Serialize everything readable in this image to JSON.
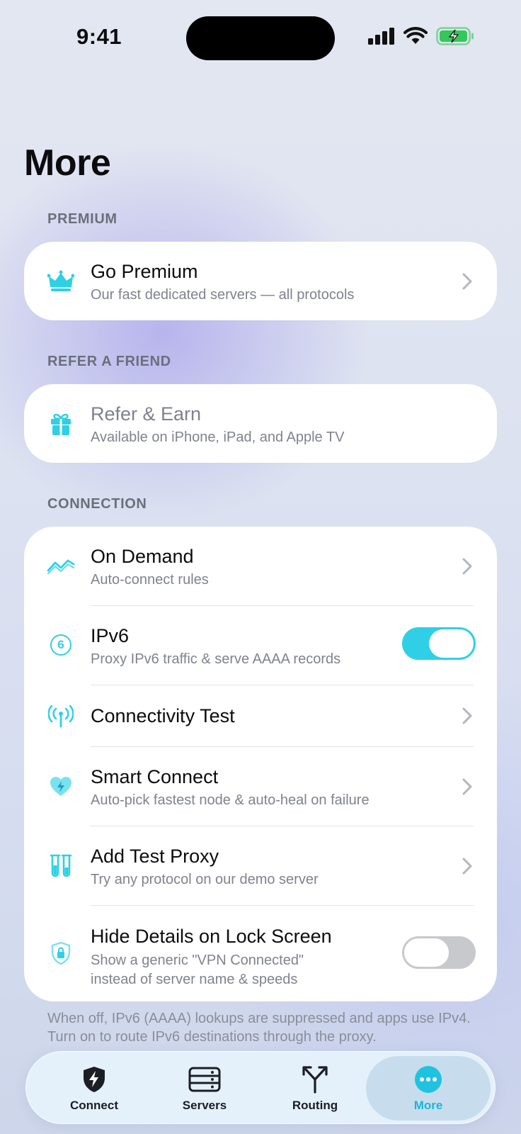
{
  "status_bar": {
    "time": "9:41"
  },
  "page": {
    "title": "More"
  },
  "sections": {
    "premium": {
      "header": "PREMIUM",
      "go_premium": {
        "title": "Go Premium",
        "subtitle": "Our fast dedicated servers — all protocols"
      }
    },
    "refer": {
      "header": "REFER A FRIEND",
      "refer_earn": {
        "title": "Refer & Earn",
        "subtitle": "Available on iPhone, iPad, and Apple TV"
      }
    },
    "connection": {
      "header": "CONNECTION",
      "on_demand": {
        "title": "On Demand",
        "subtitle": "Auto-connect rules"
      },
      "ipv6": {
        "title": "IPv6",
        "subtitle": "Proxy IPv6 traffic & serve AAAA records",
        "icon_text": "6",
        "enabled": true
      },
      "connectivity_test": {
        "title": "Connectivity Test"
      },
      "smart_connect": {
        "title": "Smart Connect",
        "subtitle": "Auto-pick fastest node & auto-heal on failure"
      },
      "add_test_proxy": {
        "title": "Add Test Proxy",
        "subtitle": "Try any protocol on our demo server"
      },
      "hide_details": {
        "title": "Hide Details on Lock Screen",
        "subtitle_line1": "Show a generic \"VPN Connected\"",
        "subtitle_line2": "instead of server name & speeds",
        "enabled": false
      }
    }
  },
  "footer_note": "When off, IPv6 (AAAA) lookups are suppressed and apps use IPv4. Turn on to route IPv6 destinations through the proxy.",
  "tabs": [
    {
      "label": "Connect",
      "icon": "bolt-shield-icon",
      "active": false
    },
    {
      "label": "Servers",
      "icon": "server-rack-icon",
      "active": false
    },
    {
      "label": "Routing",
      "icon": "fork-arrows-icon",
      "active": false
    },
    {
      "label": "More",
      "icon": "ellipsis-circle-icon",
      "active": true
    }
  ],
  "colors": {
    "accent": "#2fd0e6",
    "accent_text": "#1ab6da",
    "toggle_off": "#c8c9cd"
  }
}
